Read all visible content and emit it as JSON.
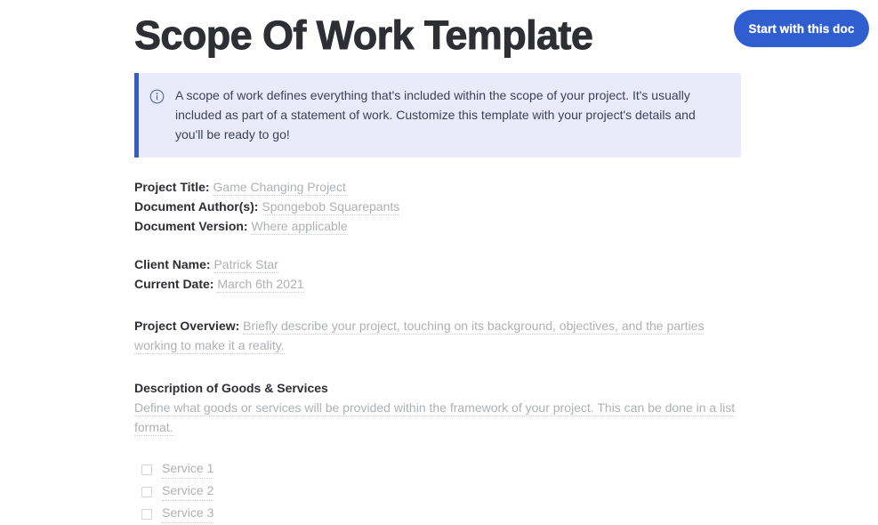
{
  "header": {
    "title": "Scope Of Work Template",
    "start_button_label": "Start with this doc",
    "accent_color": "#2f5ed0"
  },
  "callout": {
    "icon": "info-circle-icon",
    "text": "A scope of work defines everything that's included within the scope of your project. It's usually included as part of a statement of work. Customize this template with your project's details and you'll be ready to go!",
    "background_color": "#e9ebfa",
    "border_color": "#2f5ed0",
    "text_color": "#3b4257"
  },
  "document_info": {
    "project_title_label": "Project Title:",
    "project_title_value": "Game Changing Project",
    "document_author_label": "Document Author(s):",
    "document_author_value": "Spongebob Squarepants",
    "document_version_label": "Document Version:",
    "document_version_value": "Where applicable"
  },
  "client_info": {
    "client_name_label": "Client Name:",
    "client_name_value": "Patrick Star",
    "current_date_label": "Current Date:",
    "current_date_value": "March 6th 2021"
  },
  "project_overview": {
    "label": "Project Overview:",
    "placeholder": "Briefly describe your project, touching on its background, objectives, and the parties working to make it a reality."
  },
  "goods_services": {
    "heading": "Description of Goods & Services",
    "placeholder": "Define what goods or services will be provided within the framework of your project. This can be done in a list format.",
    "items": [
      {
        "label": "Service 1",
        "checked": false
      },
      {
        "label": "Service 2",
        "checked": false
      },
      {
        "label": "Service 3",
        "checked": false
      }
    ]
  },
  "placeholder_text_color": "#aeb0b4"
}
